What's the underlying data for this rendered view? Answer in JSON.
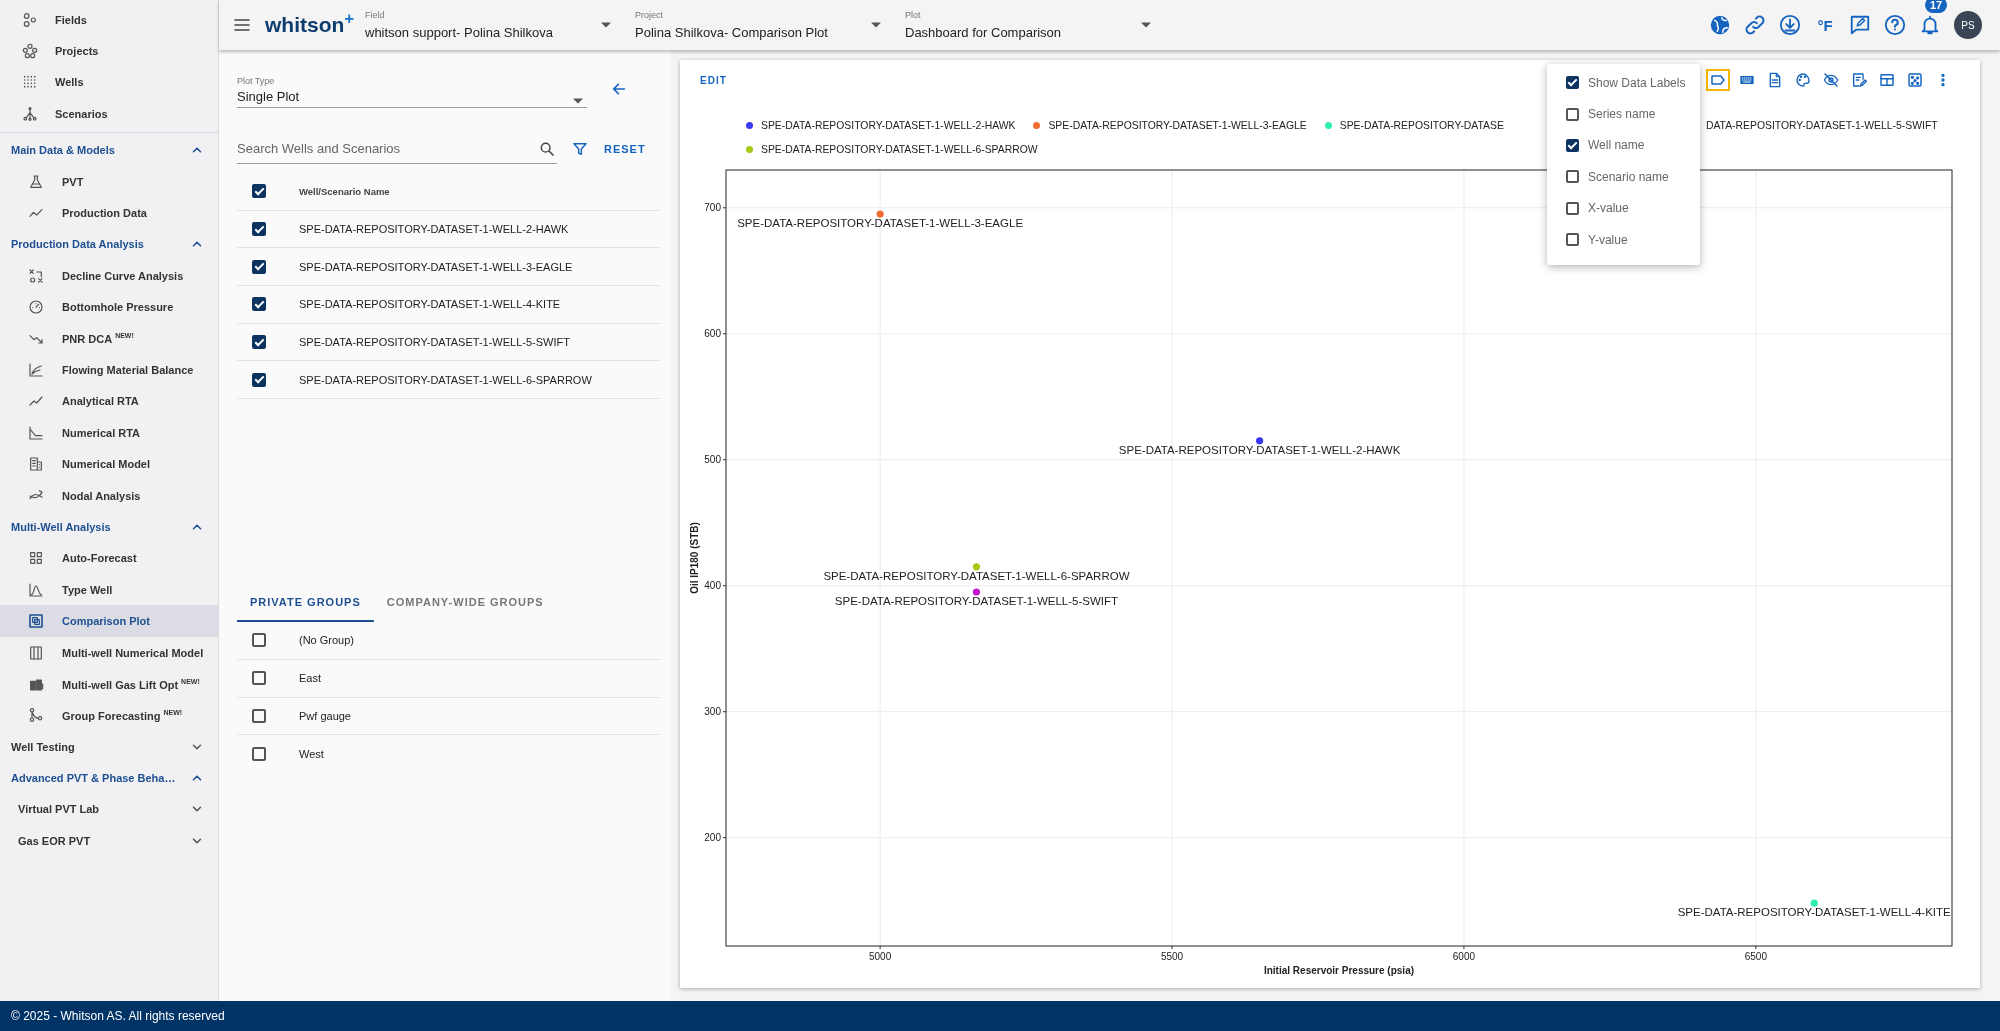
{
  "sidebar": {
    "items": [
      {
        "kind": "link",
        "label": "Fields",
        "selected": false
      },
      {
        "kind": "link",
        "label": "Projects",
        "selected": false
      },
      {
        "kind": "link",
        "label": "Wells",
        "selected": false
      },
      {
        "kind": "link",
        "label": "Scenarios",
        "selected": false
      },
      {
        "kind": "section",
        "label": "Main Data & Models",
        "expanded": true,
        "children": [
          {
            "kind": "link",
            "label": "PVT",
            "selected": false
          },
          {
            "kind": "link",
            "label": "Production Data",
            "selected": false
          }
        ]
      },
      {
        "kind": "section",
        "label": "Production Data Analysis",
        "expanded": true,
        "children": [
          {
            "kind": "link",
            "label": "Decline Curve Analysis",
            "selected": false
          },
          {
            "kind": "link",
            "label": "Bottomhole Pressure",
            "selected": false
          },
          {
            "kind": "link",
            "label": "PNR DCA",
            "badge": "NEW!",
            "selected": false
          },
          {
            "kind": "link",
            "label": "Flowing Material Balance",
            "selected": false
          },
          {
            "kind": "link",
            "label": "Analytical RTA",
            "selected": false
          },
          {
            "kind": "link",
            "label": "Numerical RTA",
            "selected": false
          },
          {
            "kind": "link",
            "label": "Numerical Model",
            "selected": false
          },
          {
            "kind": "link",
            "label": "Nodal Analysis",
            "selected": false
          }
        ]
      },
      {
        "kind": "section",
        "label": "Multi-Well Analysis",
        "expanded": true,
        "children": [
          {
            "kind": "link",
            "label": "Auto-Forecast",
            "selected": false
          },
          {
            "kind": "link",
            "label": "Type Well",
            "selected": false
          },
          {
            "kind": "link",
            "label": "Comparison Plot",
            "selected": true
          },
          {
            "kind": "link",
            "label": "Multi-well Numerical Model",
            "selected": false
          },
          {
            "kind": "link",
            "label": "Multi-well Gas Lift Opt",
            "badge": "NEW!",
            "selected": false
          },
          {
            "kind": "link",
            "label": "Group Forecasting",
            "badge": "NEW!",
            "selected": false
          }
        ]
      },
      {
        "kind": "section",
        "label": "Well Testing",
        "expanded": false
      },
      {
        "kind": "section",
        "label": "Advanced PVT & Phase Beha…",
        "expanded": true,
        "children": [
          {
            "kind": "group",
            "label": "Virtual PVT Lab",
            "expanded": false
          },
          {
            "kind": "group",
            "label": "Gas EOR PVT",
            "expanded": false
          }
        ]
      }
    ]
  },
  "topbar": {
    "logo": "whitson",
    "logo_mark": "+",
    "selectors": [
      {
        "label": "Field",
        "value": "whitson support- Polina Shilkova"
      },
      {
        "label": "Project",
        "value": "Polina Shilkova- Comparison Plot"
      },
      {
        "label": "Plot",
        "value": "Dashboard for Comparison"
      }
    ],
    "unit_toggle": "°F",
    "notification_count": "17",
    "avatar": "PS"
  },
  "left_panel": {
    "plot_type": {
      "label": "Plot Type",
      "value": "Single Plot"
    },
    "search": {
      "placeholder": "Search Wells and Scenarios"
    },
    "reset_button": "RESET",
    "wells_table": {
      "header": {
        "label": "Well/Scenario Name",
        "checked": true
      },
      "rows": [
        {
          "name": "SPE-DATA-REPOSITORY-DATASET-1-WELL-2-HAWK",
          "checked": true
        },
        {
          "name": "SPE-DATA-REPOSITORY-DATASET-1-WELL-3-EAGLE",
          "checked": true
        },
        {
          "name": "SPE-DATA-REPOSITORY-DATASET-1-WELL-4-KITE",
          "checked": true
        },
        {
          "name": "SPE-DATA-REPOSITORY-DATASET-1-WELL-5-SWIFT",
          "checked": true
        },
        {
          "name": "SPE-DATA-REPOSITORY-DATASET-1-WELL-6-SPARROW",
          "checked": true
        }
      ]
    },
    "group_tabs": [
      {
        "label": "PRIVATE GROUPS",
        "selected": true
      },
      {
        "label": "COMPANY-WIDE GROUPS",
        "selected": false
      }
    ],
    "groups": [
      {
        "name": "(No Group)",
        "checked": false
      },
      {
        "name": "East",
        "checked": false
      },
      {
        "name": "Pwf gauge",
        "checked": false
      },
      {
        "name": "West",
        "checked": false
      }
    ]
  },
  "chart_card": {
    "edit_button": "EDIT",
    "toolbar_buttons": [
      {
        "selected": true
      },
      {
        "selected": false
      },
      {
        "selected": false
      },
      {
        "selected": false
      },
      {
        "selected": false
      },
      {
        "selected": false
      },
      {
        "selected": false
      },
      {
        "selected": false
      },
      {
        "selected": false
      }
    ],
    "label_menu": {
      "items": [
        {
          "label": "Show Data Labels",
          "checked": true
        },
        {
          "label": "Series name",
          "checked": false
        },
        {
          "label": "Well name",
          "checked": true
        },
        {
          "label": "Scenario name",
          "checked": false
        },
        {
          "label": "X-value",
          "checked": false
        },
        {
          "label": "Y-value",
          "checked": false
        }
      ]
    },
    "legend": [
      {
        "label": "SPE-DATA-REPOSITORY-DATASET-1-WELL-2-HAWK",
        "color": "#3a36f5"
      },
      {
        "label": "SPE-DATA-REPOSITORY-DATASET-1-WELL-3-EAGLE",
        "color": "#f26b2f"
      },
      {
        "label": "SPE-DATA-REPOSITORY-DATASE",
        "color": "#2ef0a8"
      },
      {
        "label": "DATA-REPOSITORY-DATASET-1-WELL-5-SWIFT"
      },
      {
        "label": "SPE-DATA-REPOSITORY-DATASET-1-WELL-6-SPARROW",
        "color": "#a5c916"
      }
    ],
    "chart_data": {
      "type": "scatter",
      "xlabel": "Initial Reservoir Pressure (psia)",
      "ylabel": "Oil IP180 (STB)",
      "xlim": [
        4736,
        6836
      ],
      "ylim": [
        114,
        730
      ],
      "xticks": [
        5000,
        5500,
        6000,
        6500
      ],
      "yticks": [
        200,
        300,
        400,
        500,
        600,
        700
      ],
      "grid": true,
      "series": [
        {
          "color": "#3a36f5",
          "x": [
            5650
          ],
          "values": [
            515
          ]
        },
        {
          "color": "#f26b2f",
          "x": [
            5000
          ],
          "values": [
            695
          ]
        },
        {
          "color": "#2ef0a8",
          "x": [
            6600
          ],
          "values": [
            148
          ]
        },
        {
          "color": "#c218c9",
          "x": [
            5165
          ],
          "values": [
            395
          ]
        },
        {
          "color": "#a5c916",
          "x": [
            5165
          ],
          "values": [
            415
          ]
        }
      ],
      "annotations": [
        {
          "x": 5650,
          "y": 515,
          "text": "SPE-DATA-REPOSITORY-DATASET-1-WELL-2-HAWK"
        },
        {
          "x": 5000,
          "y": 695,
          "text": "SPE-DATA-REPOSITORY-DATASET-1-WELL-3-EAGLE"
        },
        {
          "x": 6600,
          "y": 148,
          "text": "SPE-DATA-REPOSITORY-DATASET-1-WELL-4-KITE"
        },
        {
          "x": 5165,
          "y": 395,
          "text": "SPE-DATA-REPOSITORY-DATASET-1-WELL-5-SWIFT"
        },
        {
          "x": 5165,
          "y": 415,
          "text": "SPE-DATA-REPOSITORY-DATASET-1-WELL-6-SPARROW"
        }
      ]
    }
  },
  "footer": "© 2025 - Whitson AS. All rights reserved"
}
